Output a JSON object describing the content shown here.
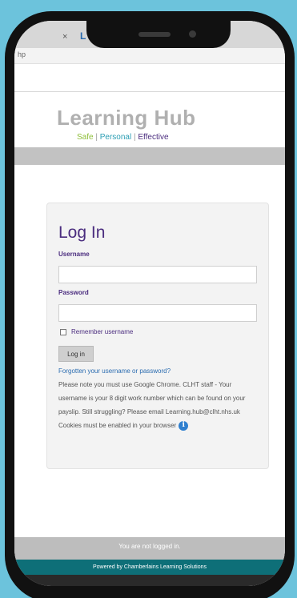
{
  "browser": {
    "tab_close": "×",
    "tab_fragment": "L",
    "url_fragment": "hp"
  },
  "site": {
    "title": "Learning Hub",
    "tagline": {
      "safe": "Safe",
      "sep": " | ",
      "personal": "Personal",
      "effective": "Effective"
    }
  },
  "login": {
    "heading": "Log In",
    "username_label": "Username",
    "username_value": "",
    "password_label": "Password",
    "password_value": "",
    "remember_label": "Remember username",
    "button_label": "Log in",
    "forgot_link": "Forgotten your username or password?",
    "note": "Please note you must use Google Chrome. CLHT staff - Your username is your 8 digit work number which can be found on your payslip. Still struggling? Please email Learning.hub@clht.nhs.uk Cookies must be enabled in your browser",
    "info_icon": "i"
  },
  "footer": {
    "status": "You are not logged in.",
    "powered_by": "Powered by Chamberlains Learning Solutions"
  },
  "colors": {
    "background": "#6cc3dc",
    "accent_purple": "#4b2d7f",
    "teal_footer": "#0e6f78",
    "green": "#8fbf3a",
    "blue": "#2a9db3"
  },
  "icons": [
    "close-icon",
    "info-icon",
    "checkbox-icon"
  ]
}
